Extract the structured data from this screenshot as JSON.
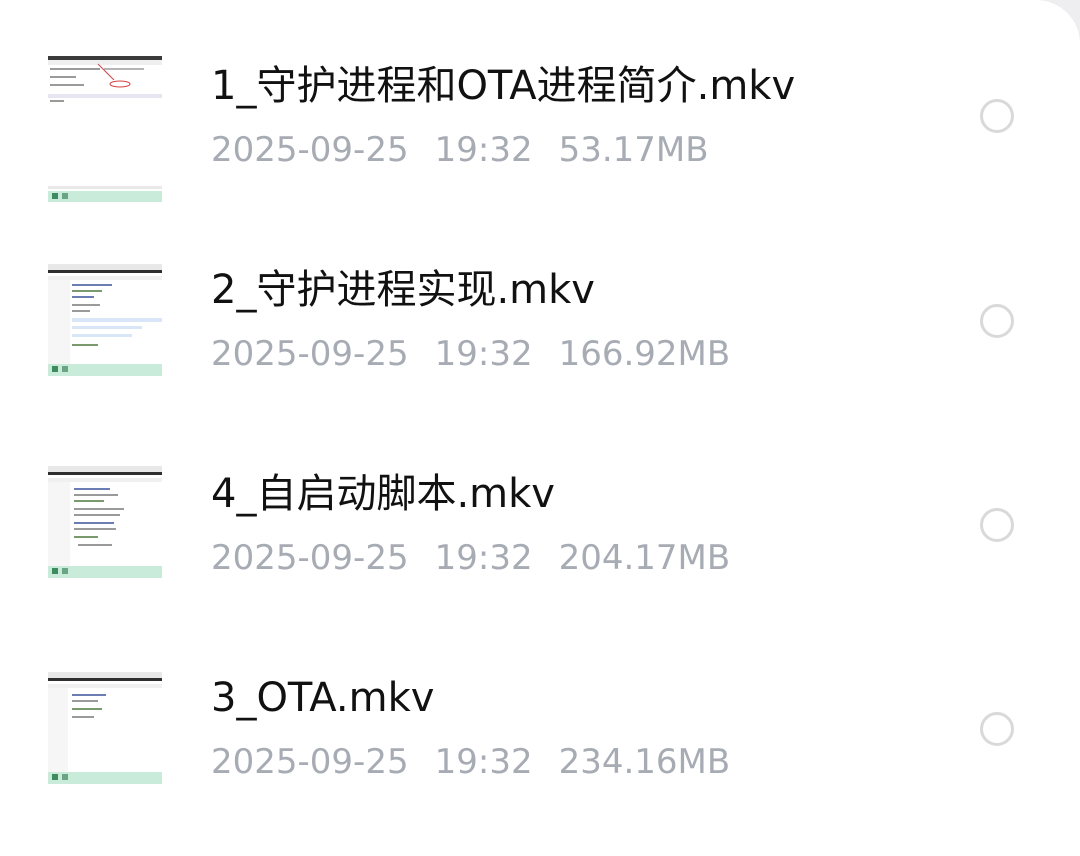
{
  "file_list": {
    "items": [
      {
        "name": "1_守护进程和OTA进程简介.mkv",
        "date": "2025-09-25",
        "time": "19:32",
        "size": "53.17MB",
        "thumbnail_icon": "video-thumbnail-icon",
        "selected": false
      },
      {
        "name": "2_守护进程实现.mkv",
        "date": "2025-09-25",
        "time": "19:32",
        "size": "166.92MB",
        "thumbnail_icon": "video-thumbnail-icon",
        "selected": false
      },
      {
        "name": "4_自启动脚本.mkv",
        "date": "2025-09-25",
        "time": "19:32",
        "size": "204.17MB",
        "thumbnail_icon": "video-thumbnail-icon",
        "selected": false
      },
      {
        "name": "3_OTA.mkv",
        "date": "2025-09-25",
        "time": "19:32",
        "size": "234.16MB",
        "thumbnail_icon": "video-thumbnail-icon",
        "selected": false
      }
    ]
  },
  "colors": {
    "name_text": "#111111",
    "meta_text": "#a7abb3",
    "radio_border": "#d9d9d9",
    "thumb_taskbar": "#c8ecd9"
  }
}
